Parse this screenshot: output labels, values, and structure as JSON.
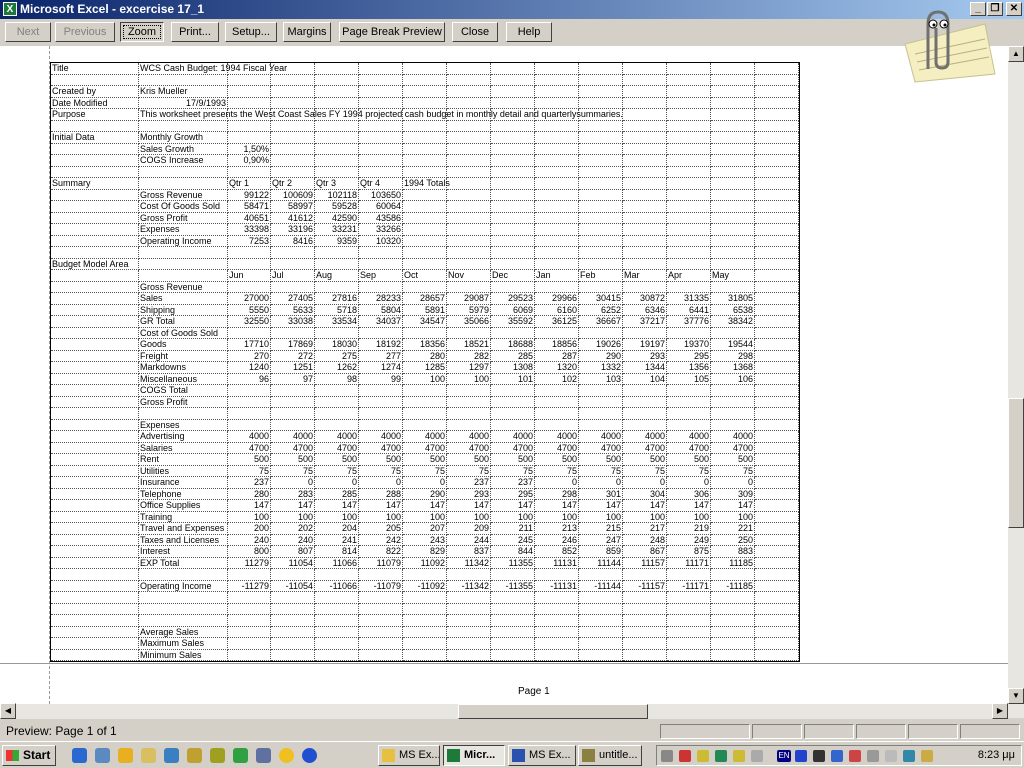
{
  "window": {
    "title": "Microsoft Excel - excercise 17_1",
    "controls": [
      "_",
      "❐",
      "✕"
    ]
  },
  "toolbar": {
    "buttons": [
      {
        "label": "Next",
        "enabled": false
      },
      {
        "label": "Previous",
        "enabled": false
      },
      {
        "label": "Zoom",
        "enabled": true,
        "pressed": true
      },
      {
        "label": "Print...",
        "enabled": true
      },
      {
        "label": "Setup...",
        "enabled": true
      },
      {
        "label": "Margins",
        "enabled": true
      },
      {
        "label": "Page Break Preview",
        "enabled": true
      },
      {
        "label": "Close",
        "enabled": true
      },
      {
        "label": "Help",
        "enabled": true
      }
    ]
  },
  "sheet": {
    "rows": [
      [
        "Title",
        "WCS Cash Budget: 1994 Fiscal Year"
      ],
      [],
      [
        "Created by",
        "Kris Mueller"
      ],
      [
        "Date Modified",
        "17/9/1993"
      ],
      [
        "Purpose",
        "This worksheet presents the West  Coast Sales FY 1994 projected cash budget in monthly detail and quarterlysummaries."
      ],
      [],
      [
        "Initial Data",
        "Monthly Growth"
      ],
      [
        "",
        "Sales Growth",
        "1,50%"
      ],
      [
        "",
        "COGS Increase",
        "0,90%"
      ],
      [],
      [
        "Summary",
        "",
        "Qtr 1",
        "Qtr 2",
        "Qtr 3",
        "Qtr 4",
        "1994 Totals"
      ],
      [
        "",
        "Gross Revenue",
        "99122",
        "100609",
        "102118",
        "103650"
      ],
      [
        "",
        "Cost Of Goods Sold",
        "58471",
        "58997",
        "59528",
        "60064"
      ],
      [
        "",
        "Gross Profit",
        "40651",
        "41612",
        "42590",
        "43586"
      ],
      [
        "",
        "Expenses",
        "33398",
        "33196",
        "33231",
        "33266"
      ],
      [
        "",
        "Operating Income",
        "7253",
        "8416",
        "9359",
        "10320"
      ],
      [],
      [
        "Budget Model Area"
      ],
      [
        "",
        "",
        "Jun",
        "Jul",
        "Aug",
        "Sep",
        "Oct",
        "Nov",
        "Dec",
        "Jan",
        "Feb",
        "Mar",
        "Apr",
        "May"
      ],
      [
        "",
        "Gross Revenue"
      ],
      [
        "",
        "Sales",
        "27000",
        "27405",
        "27816",
        "28233",
        "28657",
        "29087",
        "29523",
        "29966",
        "30415",
        "30872",
        "31335",
        "31805"
      ],
      [
        "",
        "Shipping",
        "5550",
        "5633",
        "5718",
        "5804",
        "5891",
        "5979",
        "6069",
        "6160",
        "6252",
        "6346",
        "6441",
        "6538"
      ],
      [
        "",
        "GR Total",
        "32550",
        "33038",
        "33534",
        "34037",
        "34547",
        "35066",
        "35592",
        "36125",
        "36667",
        "37217",
        "37776",
        "38342"
      ],
      [
        "",
        "Cost of Goods Sold"
      ],
      [
        "",
        "Goods",
        "17710",
        "17869",
        "18030",
        "18192",
        "18356",
        "18521",
        "18688",
        "18856",
        "19026",
        "19197",
        "19370",
        "19544"
      ],
      [
        "",
        "Freight",
        "270",
        "272",
        "275",
        "277",
        "280",
        "282",
        "285",
        "287",
        "290",
        "293",
        "295",
        "298"
      ],
      [
        "",
        "Markdowns",
        "1240",
        "1251",
        "1262",
        "1274",
        "1285",
        "1297",
        "1308",
        "1320",
        "1332",
        "1344",
        "1356",
        "1368"
      ],
      [
        "",
        "Miscellaneous",
        "96",
        "97",
        "98",
        "99",
        "100",
        "100",
        "101",
        "102",
        "103",
        "104",
        "105",
        "106"
      ],
      [
        "",
        "COGS Total"
      ],
      [
        "",
        "Gross Profit"
      ],
      [],
      [
        "",
        "Expenses"
      ],
      [
        "",
        "Advertising",
        "4000",
        "4000",
        "4000",
        "4000",
        "4000",
        "4000",
        "4000",
        "4000",
        "4000",
        "4000",
        "4000",
        "4000"
      ],
      [
        "",
        "Salaries",
        "4700",
        "4700",
        "4700",
        "4700",
        "4700",
        "4700",
        "4700",
        "4700",
        "4700",
        "4700",
        "4700",
        "4700"
      ],
      [
        "",
        "Rent",
        "500",
        "500",
        "500",
        "500",
        "500",
        "500",
        "500",
        "500",
        "500",
        "500",
        "500",
        "500"
      ],
      [
        "",
        "Utilities",
        "75",
        "75",
        "75",
        "75",
        "75",
        "75",
        "75",
        "75",
        "75",
        "75",
        "75",
        "75"
      ],
      [
        "",
        "Insurance",
        "237",
        "0",
        "0",
        "0",
        "0",
        "237",
        "237",
        "0",
        "0",
        "0",
        "0",
        "0"
      ],
      [
        "",
        "Telephone",
        "280",
        "283",
        "285",
        "288",
        "290",
        "293",
        "295",
        "298",
        "301",
        "304",
        "306",
        "309"
      ],
      [
        "",
        "Office Supplies",
        "147",
        "147",
        "147",
        "147",
        "147",
        "147",
        "147",
        "147",
        "147",
        "147",
        "147",
        "147"
      ],
      [
        "",
        "Training",
        "100",
        "100",
        "100",
        "100",
        "100",
        "100",
        "100",
        "100",
        "100",
        "100",
        "100",
        "100"
      ],
      [
        "",
        "Travel and Expenses",
        "200",
        "202",
        "204",
        "205",
        "207",
        "209",
        "211",
        "213",
        "215",
        "217",
        "219",
        "221"
      ],
      [
        "",
        "Taxes and Licenses",
        "240",
        "240",
        "241",
        "242",
        "243",
        "244",
        "245",
        "246",
        "247",
        "248",
        "249",
        "250"
      ],
      [
        "",
        "Interest",
        "800",
        "807",
        "814",
        "822",
        "829",
        "837",
        "844",
        "852",
        "859",
        "867",
        "875",
        "883"
      ],
      [
        "",
        "EXP Total",
        "11279",
        "11054",
        "11066",
        "11079",
        "11092",
        "11342",
        "11355",
        "11131",
        "11144",
        "11157",
        "11171",
        "11185"
      ],
      [],
      [
        "",
        "Operating Income",
        "-11279",
        "-11054",
        "-11066",
        "-11079",
        "-11092",
        "-11342",
        "-11355",
        "-11131",
        "-11144",
        "-11157",
        "-11171",
        "-11185"
      ],
      [],
      [],
      [],
      [
        "",
        "Average Sales"
      ],
      [
        "",
        "Maximum Sales"
      ],
      [
        "",
        "Minimum Sales"
      ]
    ],
    "page_label": "Page 1"
  },
  "status": {
    "text": "Preview: Page 1 of 1"
  },
  "taskbar": {
    "start": "Start",
    "tasks": [
      {
        "label": "MS Ex...",
        "active": false
      },
      {
        "label": "Micr...",
        "active": true
      },
      {
        "label": "MS Ex...",
        "active": false
      },
      {
        "label": "untitle...",
        "active": false
      }
    ],
    "clock": "8:23 μμ",
    "language": "EN"
  }
}
